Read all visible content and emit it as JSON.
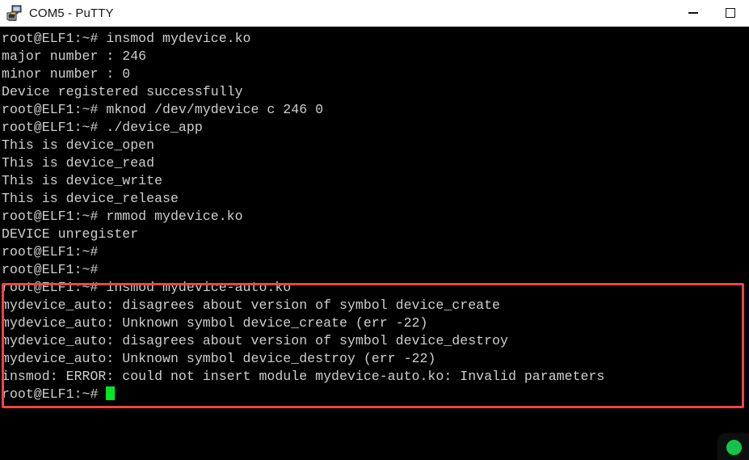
{
  "window": {
    "title": "COM5 - PuTTY",
    "icon": "putty-terminal-icon",
    "controls": {
      "minimize_label": "Minimize",
      "maximize_label": "Maximize"
    }
  },
  "terminal": {
    "background_color": "#000000",
    "text_color": "#cfcfcf",
    "cursor_color": "#00e624",
    "prompt": "root@ELF1:~#",
    "lines": [
      "root@ELF1:~# insmod mydevice.ko",
      "major number : 246",
      "minor number : 0",
      "Device registered successfully",
      "root@ELF1:~# mknod /dev/mydevice c 246 0",
      "root@ELF1:~# ./device_app",
      "This is device_open",
      "This is device_read",
      "This is device_write",
      "This is device_release",
      "root@ELF1:~# rmmod mydevice.ko",
      "DEVICE unregister",
      "root@ELF1:~#",
      "root@ELF1:~#",
      "root@ELF1:~# insmod mydevice-auto.ko",
      "mydevice_auto: disagrees about version of symbol device_create",
      "mydevice_auto: Unknown symbol device_create (err -22)",
      "mydevice_auto: disagrees about version of symbol device_destroy",
      "mydevice_auto: Unknown symbol device_destroy (err -22)",
      "insmod: ERROR: could not insert module mydevice-auto.ko: Invalid parameters"
    ],
    "final_prompt": "root@ELF1:~# "
  },
  "annotation": {
    "highlight_color": "#ef4444",
    "highlight_label": "error-output-highlight"
  },
  "status_indicator": {
    "color": "#13c44a",
    "label": "connection-active"
  }
}
